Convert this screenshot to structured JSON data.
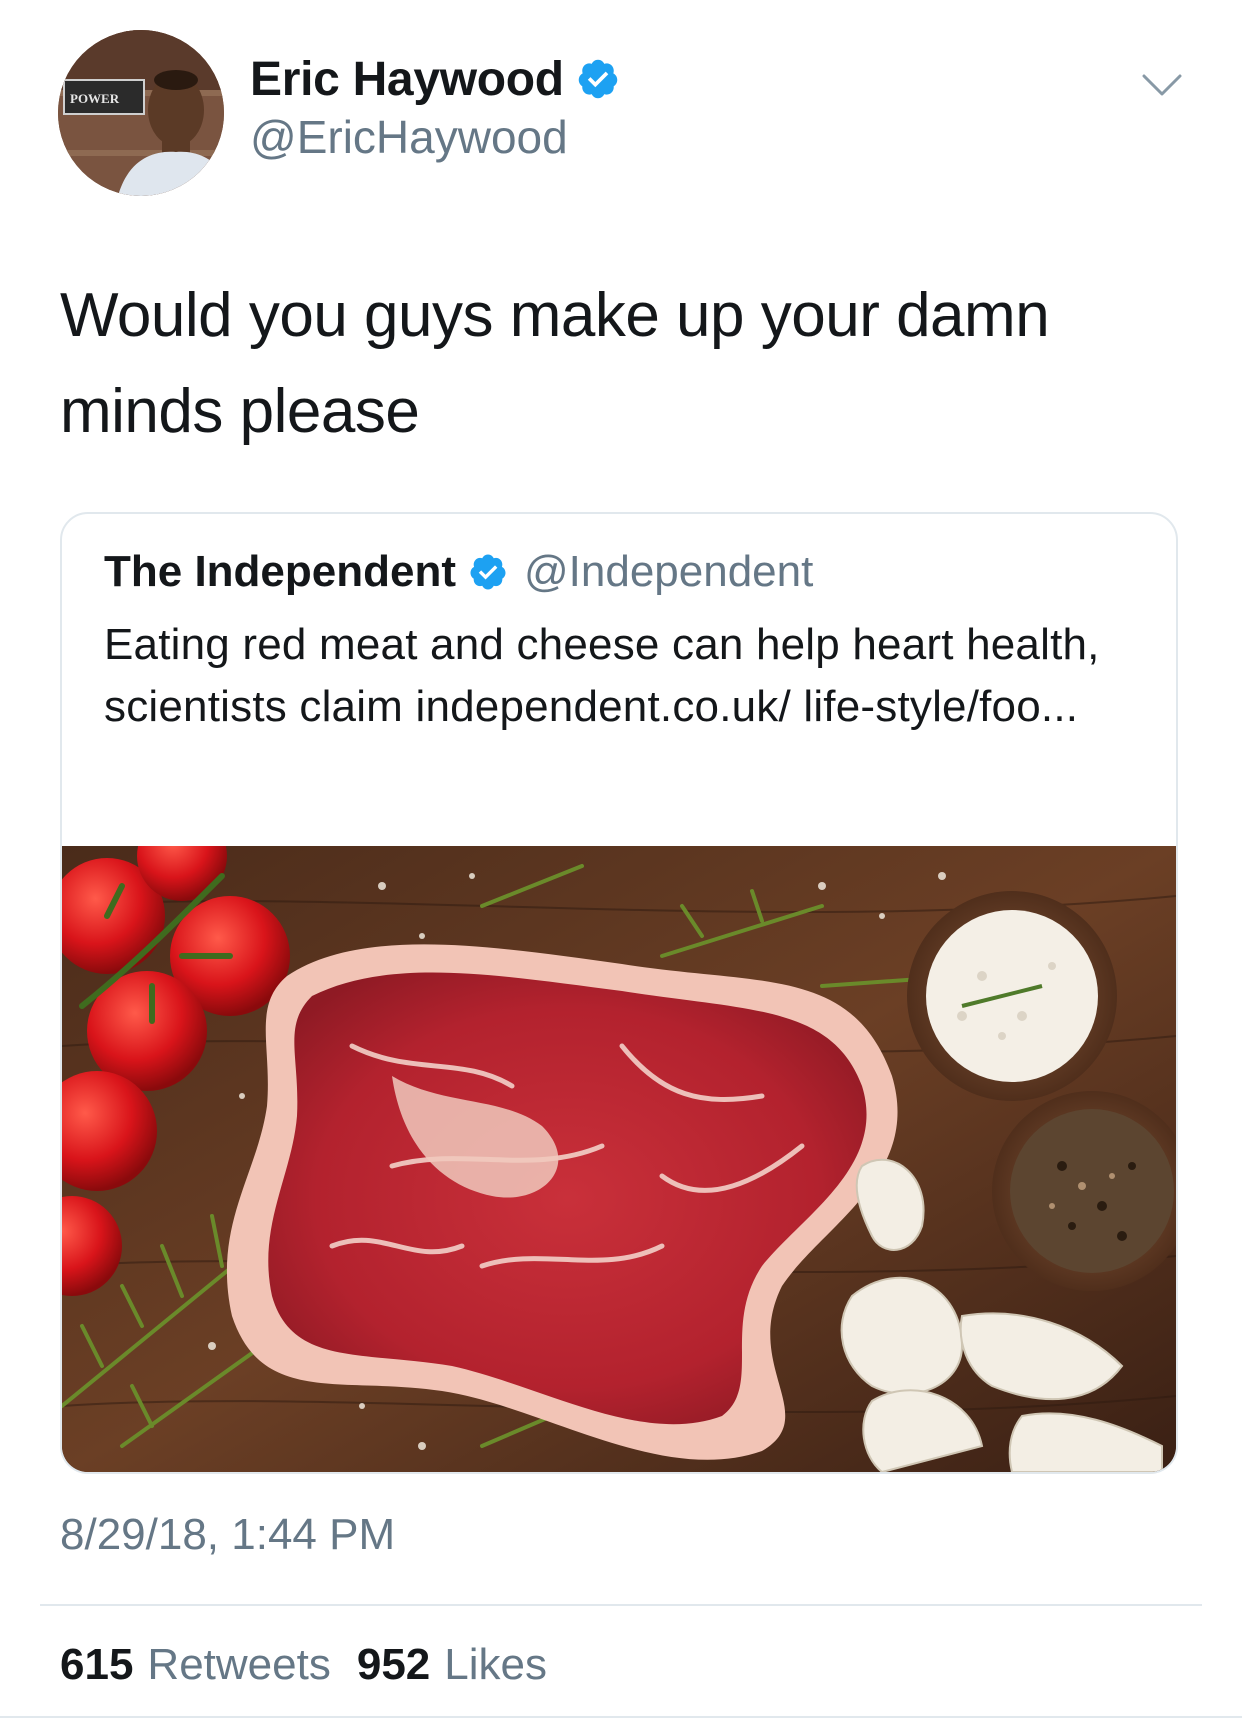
{
  "author": {
    "display_name": "Eric Haywood",
    "handle": "@EricHaywood",
    "verified": true,
    "avatar_sign_text": "POWER"
  },
  "tweet": {
    "text": "Would you guys make up your damn minds please",
    "timestamp": "8/29/18, 1:44 PM"
  },
  "quoted_tweet": {
    "display_name": "The Independent",
    "handle": "@Independent",
    "verified": true,
    "text": "Eating red meat and cheese can help heart health, scientists claim independent.co.uk/ life-style/foo..."
  },
  "stats": {
    "retweets_count": "615",
    "retweets_label": "Retweets",
    "likes_count": "952",
    "likes_label": "Likes"
  },
  "colors": {
    "verified_blue": "#1da1f2",
    "secondary_text": "#657786",
    "primary_text": "#14171a",
    "border": "#e1e8ed"
  },
  "icons": {
    "verified": "verified-badge-icon",
    "caret": "chevron-down-icon"
  }
}
